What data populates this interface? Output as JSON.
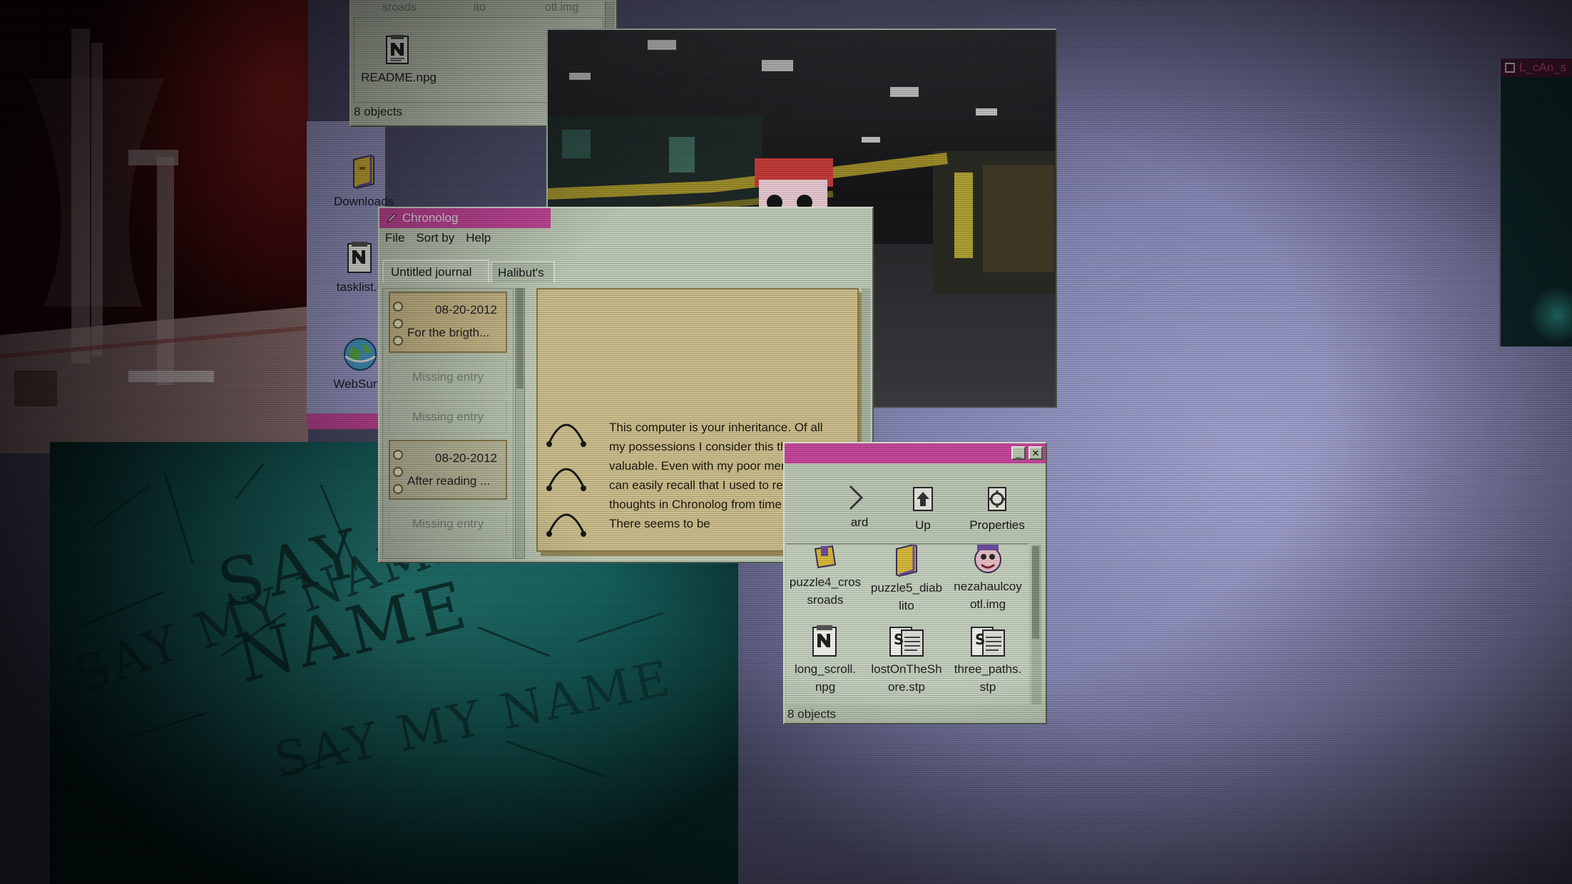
{
  "top_explorer": {
    "column_fragments": [
      "sroads",
      "ito",
      "otl.img"
    ],
    "file_name": "README.npg",
    "status": "8 objects"
  },
  "desktop_icons": [
    {
      "label": "Downloads",
      "icon": "folder-icon"
    },
    {
      "label": "tasklist.n",
      "icon": "notepad-icon"
    },
    {
      "label": "WebSurfe",
      "icon": "globe-icon"
    }
  ],
  "chronolog": {
    "title": "Chronolog",
    "menu": [
      "File",
      "Sort by",
      "Help"
    ],
    "tabs": [
      "Untitled journal",
      "Halibut's"
    ],
    "entries": [
      {
        "date": "08-20-2012",
        "preview": "For the brigth..."
      },
      {
        "missing": "Missing entry"
      },
      {
        "missing": "Missing entry"
      },
      {
        "date": "08-20-2012",
        "preview": "After reading ..."
      },
      {
        "missing": "Missing entry"
      }
    ],
    "journal_text": "This computer is your inheritance. Of all my possessions I consider this the most valuable. Even with my poor memory, I can easily recall that I used to record my thoughts in Chronolog from time to time. There seems to be"
  },
  "explorer": {
    "toolbar": [
      {
        "label": "ard",
        "icon": "forward-arrow-icon"
      },
      {
        "label": "Up",
        "icon": "up-folder-icon"
      },
      {
        "label": "Properties",
        "icon": "properties-icon"
      }
    ],
    "files": [
      {
        "line1": "puzzle4_cros",
        "line2": "sroads",
        "icon": "puzzle-icon"
      },
      {
        "line1": "puzzle5_diab",
        "line2": "lito",
        "icon": "puzzle-folder-icon"
      },
      {
        "line1": "nezahaulcoy",
        "line2": "otl.img",
        "icon": "image-icon"
      },
      {
        "line1": "long_scroll.",
        "line2": "npg",
        "icon": "notepad-icon"
      },
      {
        "line1": "lostOnTheSh",
        "line2": "ore.stp",
        "icon": "script-icon"
      },
      {
        "line1": "three_paths.",
        "line2": "stp",
        "icon": "script-icon"
      }
    ],
    "status": "8 objects"
  },
  "right_window": {
    "title": "L_cAn_s"
  },
  "wall_writing": "SAY MY NAME",
  "colors": {
    "desktop": "#9a9ac8",
    "title_accent": "#c4479a",
    "window_body": "#bac6b2",
    "entry_tan": "#c7b888",
    "teal_photo": "#1a6d69",
    "red_photo": "#7a1818"
  }
}
